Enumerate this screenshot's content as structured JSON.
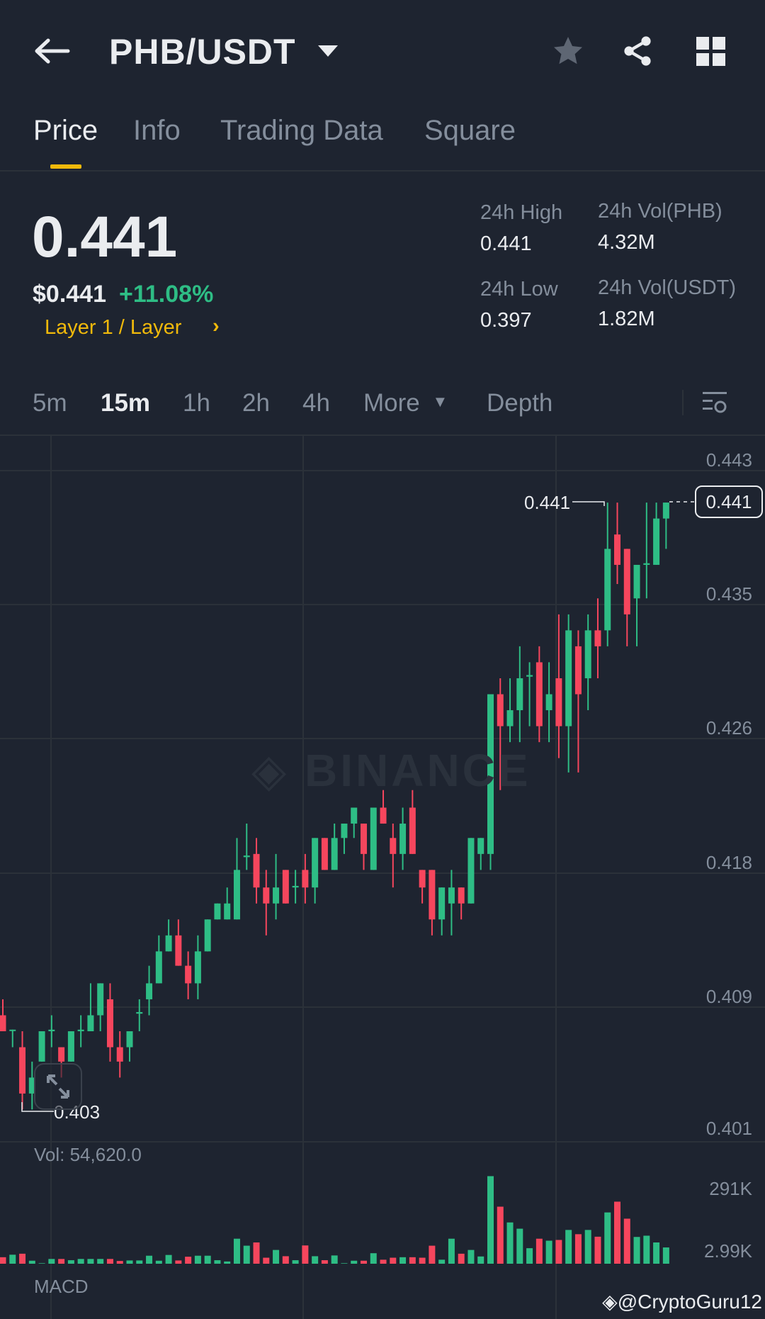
{
  "header": {
    "pair": "PHB/USDT",
    "icons": [
      "back-arrow-icon",
      "caret-down-icon",
      "star-icon",
      "share-icon",
      "grid-icon"
    ]
  },
  "tabs": [
    {
      "label": "Price",
      "active": true
    },
    {
      "label": "Info"
    },
    {
      "label": "Trading Data"
    },
    {
      "label": "Square"
    }
  ],
  "ticker": {
    "last_price": "0.441",
    "usd_price": "$0.441",
    "change": "+11.08%",
    "tag": "Layer 1 / Layer",
    "high_label": "24h High",
    "high": "0.441",
    "low_label": "24h Low",
    "low": "0.397",
    "vol_base_label": "24h Vol(PHB)",
    "vol_base": "4.32M",
    "vol_quote_label": "24h Vol(USDT)",
    "vol_quote": "1.82M"
  },
  "intervals": [
    {
      "label": "5m"
    },
    {
      "label": "15m",
      "active": true
    },
    {
      "label": "1h"
    },
    {
      "label": "2h"
    },
    {
      "label": "4h"
    },
    {
      "label": "More"
    },
    {
      "label": "Depth"
    }
  ],
  "colors": {
    "up": "#2ebd85",
    "down": "#f6465d",
    "accent": "#f0b90b",
    "bg": "#1e2430"
  },
  "watermark": "BINANCE",
  "credit": "@CryptoGuru12",
  "macd_label": "MACD",
  "chart_data": {
    "type": "candlestick",
    "interval": "15m",
    "y_ticks": [
      "0.443",
      "0.435",
      "0.426",
      "0.418",
      "0.409",
      "0.401"
    ],
    "ylim": [
      0.401,
      0.443
    ],
    "high_marker": "0.441",
    "low_marker": "0.403",
    "current_price": "0.441",
    "ohlc": [
      [
        0.4089,
        0.4099,
        0.4079,
        0.4079
      ],
      [
        0.408,
        0.408,
        0.4069,
        0.408
      ],
      [
        0.4069,
        0.4079,
        0.403,
        0.404
      ],
      [
        0.404,
        0.406,
        0.403,
        0.405
      ],
      [
        0.406,
        0.4079,
        0.406,
        0.4079
      ],
      [
        0.4079,
        0.4089,
        0.4069,
        0.408
      ],
      [
        0.4069,
        0.4069,
        0.405,
        0.406
      ],
      [
        0.406,
        0.4079,
        0.406,
        0.4079
      ],
      [
        0.4079,
        0.4089,
        0.4069,
        0.408
      ],
      [
        0.4079,
        0.4109,
        0.4079,
        0.4089
      ],
      [
        0.4089,
        0.4109,
        0.4079,
        0.4109
      ],
      [
        0.4099,
        0.4109,
        0.406,
        0.4069
      ],
      [
        0.4069,
        0.4079,
        0.405,
        0.406
      ],
      [
        0.4069,
        0.4079,
        0.406,
        0.4079
      ],
      [
        0.409,
        0.4099,
        0.4079,
        0.4091
      ],
      [
        0.4099,
        0.412,
        0.4089,
        0.4109
      ],
      [
        0.4109,
        0.4139,
        0.4109,
        0.4129
      ],
      [
        0.4129,
        0.4149,
        0.4129,
        0.4139
      ],
      [
        0.4139,
        0.4149,
        0.412,
        0.412
      ],
      [
        0.412,
        0.4129,
        0.4099,
        0.4109
      ],
      [
        0.4109,
        0.4139,
        0.4099,
        0.4129
      ],
      [
        0.4129,
        0.4149,
        0.4129,
        0.4149
      ],
      [
        0.4149,
        0.4159,
        0.4149,
        0.4159
      ],
      [
        0.4149,
        0.4169,
        0.4149,
        0.4159
      ],
      [
        0.4149,
        0.42,
        0.4149,
        0.418
      ],
      [
        0.4188,
        0.4209,
        0.418,
        0.4189
      ],
      [
        0.419,
        0.42,
        0.4159,
        0.4169
      ],
      [
        0.4169,
        0.418,
        0.4139,
        0.4159
      ],
      [
        0.4159,
        0.419,
        0.4149,
        0.4169
      ],
      [
        0.418,
        0.418,
        0.4159,
        0.4159
      ],
      [
        0.4169,
        0.418,
        0.4159,
        0.417
      ],
      [
        0.418,
        0.419,
        0.4159,
        0.4169
      ],
      [
        0.4169,
        0.42,
        0.4159,
        0.42
      ],
      [
        0.42,
        0.42,
        0.418,
        0.418
      ],
      [
        0.418,
        0.4209,
        0.418,
        0.42
      ],
      [
        0.42,
        0.4209,
        0.419,
        0.4209
      ],
      [
        0.4209,
        0.4219,
        0.42,
        0.4219
      ],
      [
        0.4209,
        0.4209,
        0.418,
        0.419
      ],
      [
        0.418,
        0.4219,
        0.418,
        0.4219
      ],
      [
        0.4219,
        0.423,
        0.4209,
        0.4209
      ],
      [
        0.42,
        0.4209,
        0.4169,
        0.419
      ],
      [
        0.419,
        0.4219,
        0.418,
        0.4209
      ],
      [
        0.4219,
        0.423,
        0.419,
        0.419
      ],
      [
        0.418,
        0.418,
        0.4159,
        0.4169
      ],
      [
        0.418,
        0.418,
        0.4139,
        0.4149
      ],
      [
        0.4149,
        0.4169,
        0.4139,
        0.4169
      ],
      [
        0.4159,
        0.418,
        0.4139,
        0.4169
      ],
      [
        0.4169,
        0.4169,
        0.4149,
        0.4159
      ],
      [
        0.4159,
        0.42,
        0.4159,
        0.42
      ],
      [
        0.419,
        0.42,
        0.418,
        0.42
      ],
      [
        0.419,
        0.429,
        0.418,
        0.429
      ],
      [
        0.429,
        0.43,
        0.423,
        0.427
      ],
      [
        0.427,
        0.43,
        0.426,
        0.428
      ],
      [
        0.428,
        0.432,
        0.426,
        0.43
      ],
      [
        0.4301,
        0.431,
        0.427,
        0.4302
      ],
      [
        0.431,
        0.432,
        0.426,
        0.427
      ],
      [
        0.428,
        0.431,
        0.426,
        0.429
      ],
      [
        0.43,
        0.434,
        0.425,
        0.427
      ],
      [
        0.427,
        0.434,
        0.4241,
        0.433
      ],
      [
        0.432,
        0.433,
        0.4241,
        0.429
      ],
      [
        0.43,
        0.434,
        0.428,
        0.433
      ],
      [
        0.433,
        0.435,
        0.43,
        0.432
      ],
      [
        0.433,
        0.441,
        0.432,
        0.4381
      ],
      [
        0.439,
        0.441,
        0.4359,
        0.4371
      ],
      [
        0.4381,
        0.4381,
        0.432,
        0.434
      ],
      [
        0.435,
        0.4371,
        0.432,
        0.4371
      ],
      [
        0.4371,
        0.441,
        0.435,
        0.4372
      ],
      [
        0.4371,
        0.441,
        0.4371,
        0.44
      ],
      [
        0.44,
        0.441,
        0.4381,
        0.441
      ]
    ],
    "volume_label": "Vol: 54,620.0",
    "volume_ticks": [
      "291K",
      "2.99K"
    ],
    "volume_k": [
      26,
      36,
      40,
      12,
      2,
      19,
      19,
      14,
      19,
      19,
      19,
      19,
      11,
      13,
      13,
      32,
      12,
      35,
      13,
      28,
      32,
      32,
      14,
      9,
      100,
      72,
      85,
      24,
      55,
      30,
      14,
      73,
      30,
      14,
      33,
      2,
      12,
      12,
      42,
      16,
      24,
      26,
      26,
      24,
      72,
      16,
      100,
      40,
      55,
      29,
      350,
      228,
      165,
      140,
      62,
      100,
      92,
      95,
      135,
      118,
      135,
      108,
      205,
      248,
      180,
      107,
      112,
      85,
      65
    ]
  }
}
